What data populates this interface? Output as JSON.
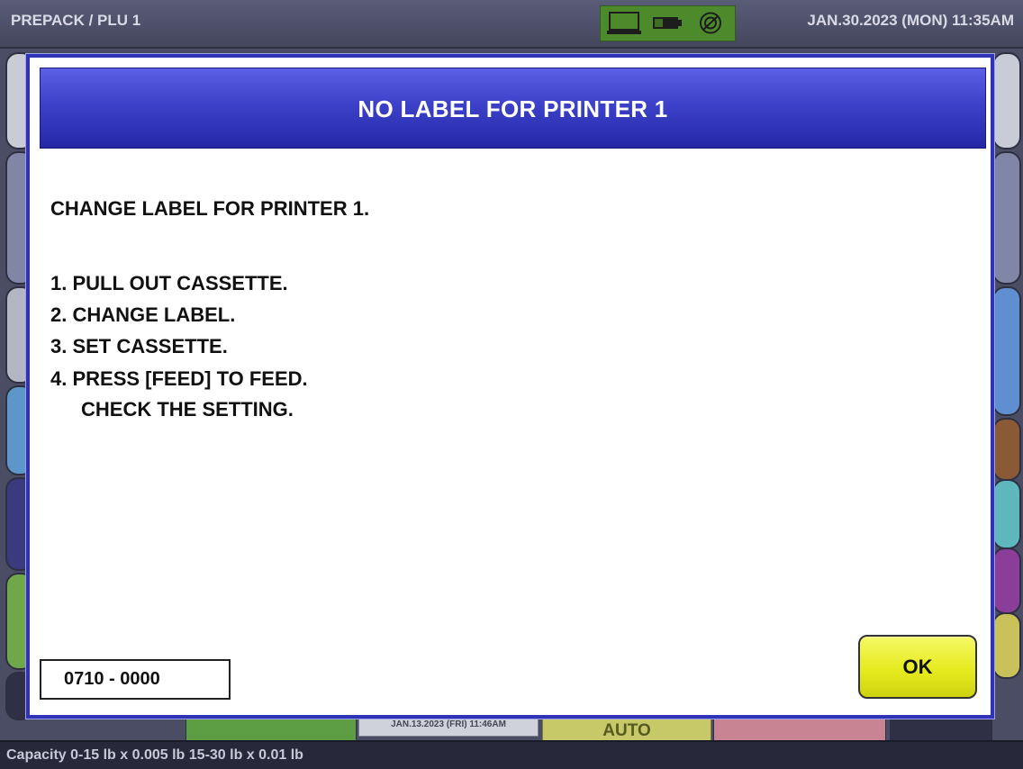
{
  "topbar": {
    "title": "PREPACK / PLU 1",
    "datetime": "JAN.30.2023 (MON) 11:35AM",
    "status_icons": [
      "computer-icon",
      "battery-icon",
      "network-icon"
    ]
  },
  "background": {
    "date_label": "JAN.13.2023 (FRI) 11:46AM",
    "auto_label": "AUTO"
  },
  "dialog": {
    "title": "NO LABEL FOR PRINTER 1",
    "message_heading": "CHANGE LABEL FOR PRINTER 1.",
    "steps": [
      "1. PULL OUT CASSETTE.",
      "2. CHANGE LABEL.",
      "3. SET CASSETTE.",
      "4. PRESS [FEED] TO FEED."
    ],
    "note": "CHECK THE SETTING.",
    "code": "0710 - 0000",
    "ok_label": "OK"
  },
  "footer": {
    "capacity": "Capacity 0-15 lb x 0.005 lb  15-30 lb x 0.01 lb"
  },
  "colors": {
    "dialog_border": "#2f33b8",
    "header_blue": "#3d41c9",
    "ok_yellow": "#e6eb1f",
    "status_green": "#4d8a2c"
  }
}
